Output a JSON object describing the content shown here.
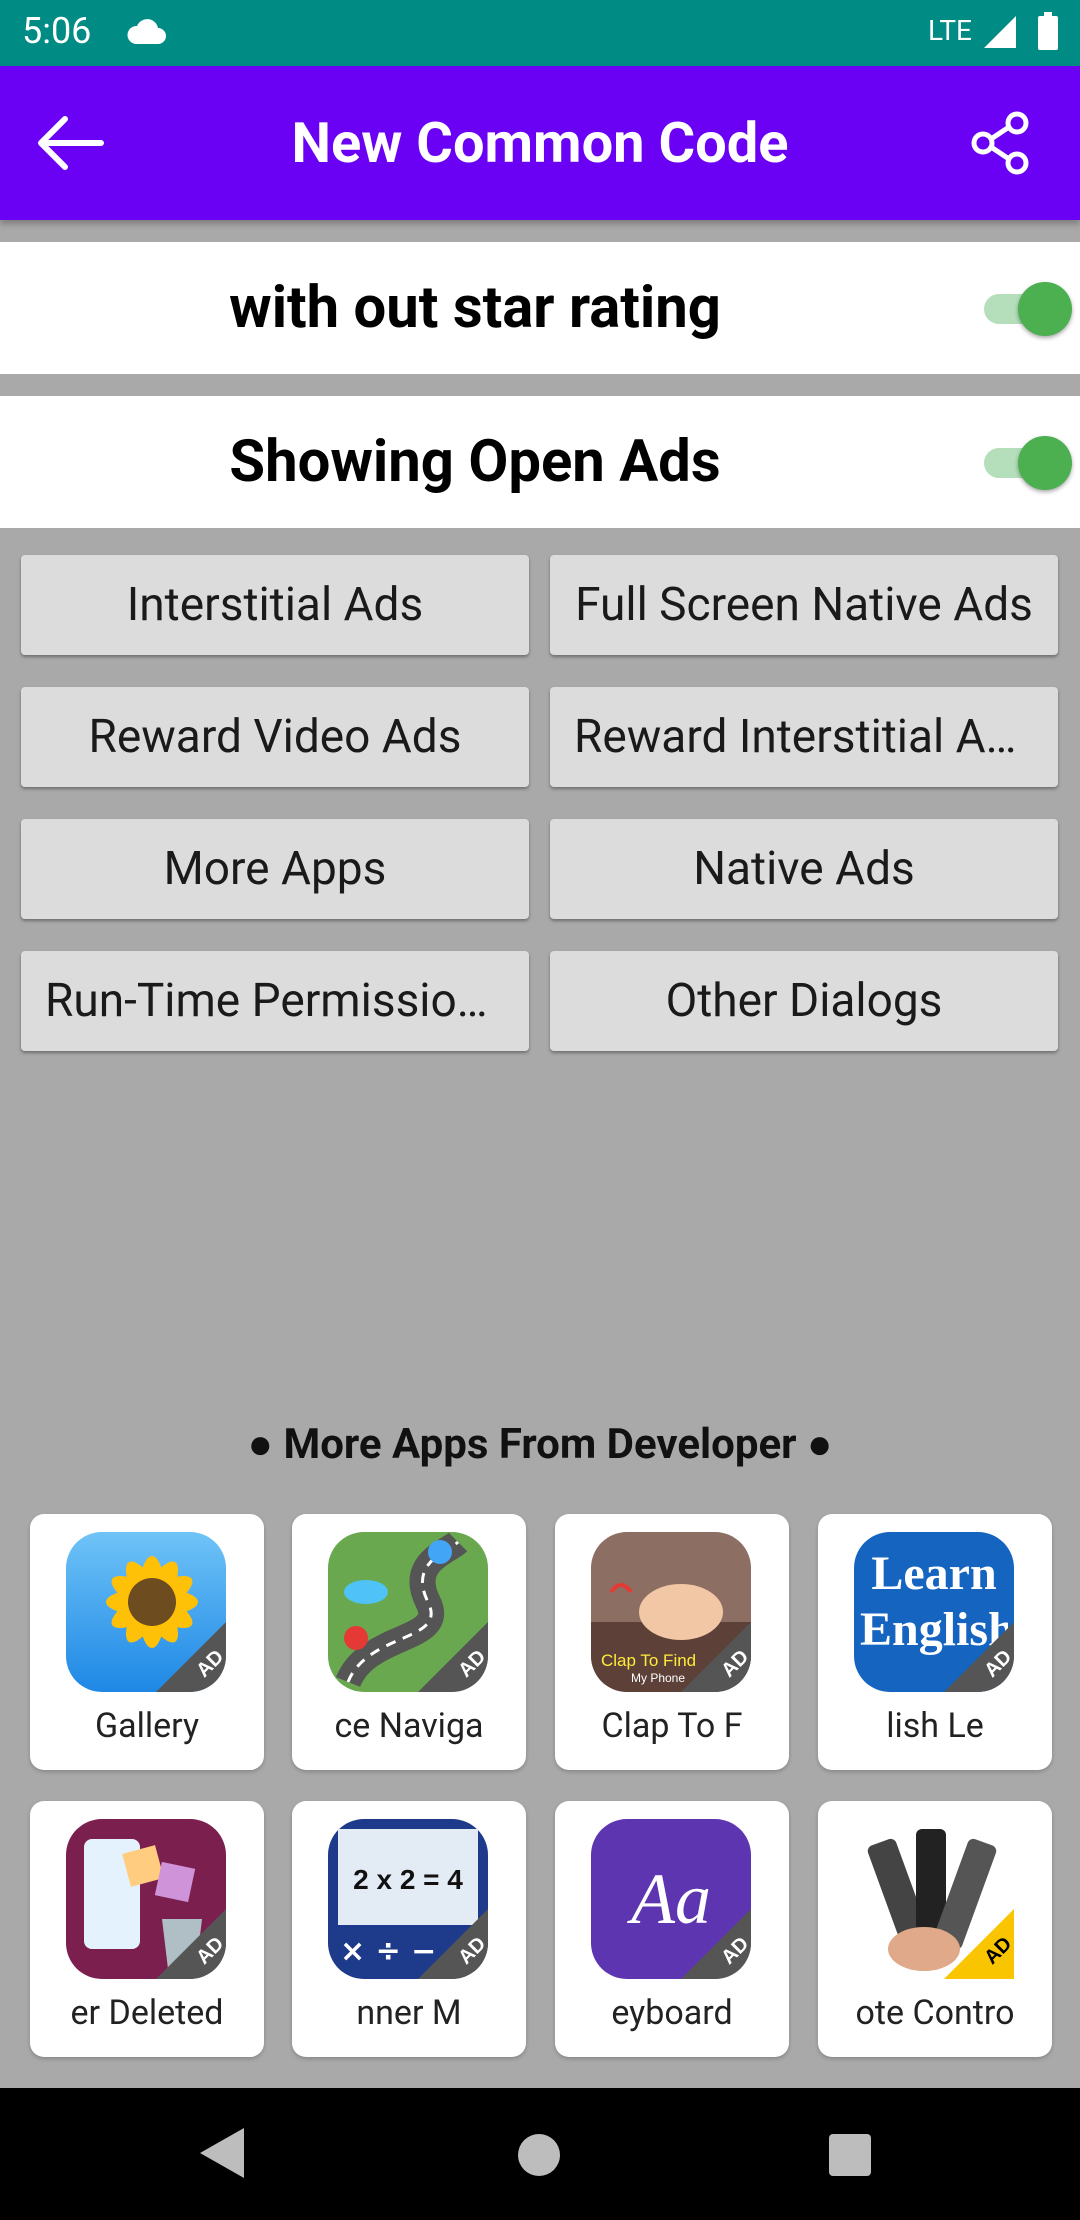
{
  "status_bar": {
    "time": "5:06",
    "network": "LTE"
  },
  "app_bar": {
    "title": "New Common Code",
    "back_icon": "arrow-back-icon",
    "share_icon": "share-icon"
  },
  "toggles": [
    {
      "label": "with out star rating",
      "on": true
    },
    {
      "label": "Showing Open Ads",
      "on": true
    }
  ],
  "buttons": [
    "Interstitial Ads",
    "Full Screen Native Ads",
    "Reward Video Ads",
    "Reward Interstitial Ads",
    "More Apps",
    "Native Ads",
    "Run-Time Permissions",
    "Other Dialogs"
  ],
  "more_apps": {
    "header": "● More Apps From Developer ●",
    "badge": "AD",
    "apps": [
      {
        "name": "Gallery",
        "icon": "sunflower-gallery-icon"
      },
      {
        "name": "ce Naviga",
        "icon": "road-navigation-icon"
      },
      {
        "name": "Clap To F",
        "icon": "clap-to-find-icon",
        "icon_text": "Clap To Find",
        "icon_subtext": "My Phone"
      },
      {
        "name": "lish      Le",
        "icon": "learn-english-icon",
        "icon_text": "Learn English"
      },
      {
        "name": "er Deleted",
        "icon": "recover-deleted-photos-icon"
      },
      {
        "name": "nner      M",
        "icon": "math-scanner-icon",
        "icon_text": "2 x 2 = 4"
      },
      {
        "name": "eyboard",
        "icon": "keyboard-aa-icon",
        "icon_text": "Aa"
      },
      {
        "name": "ote Contro",
        "icon": "remote-control-icon"
      }
    ]
  },
  "colors": {
    "status_bar": "#008b84",
    "app_bar": "#6a00f4",
    "background": "#a9a9a9",
    "switch_on": "#4caf50"
  }
}
